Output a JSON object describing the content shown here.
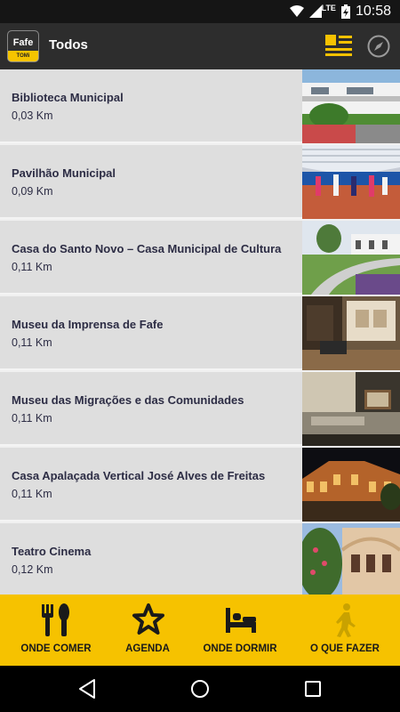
{
  "status": {
    "time": "10:58",
    "network": "LTE"
  },
  "app": {
    "logo_title": "Fafe",
    "logo_tag": "TOMi",
    "title": "Todos"
  },
  "icons": {
    "view_toggle": "list-view-icon",
    "compass": "compass-icon"
  },
  "colors": {
    "accent": "#f6c200",
    "appbar": "#2d2d2d",
    "row_bg": "#dedede",
    "text": "#2c2c44"
  },
  "places": [
    {
      "name": "Biblioteca Municipal",
      "distance": "0,03 Km",
      "image": "library-building-photo"
    },
    {
      "name": "Pavilhão Municipal",
      "distance": "0,09 Km",
      "image": "sports-hall-photo"
    },
    {
      "name": "Casa do Santo Novo – Casa Municipal de Cultura",
      "distance": "0,11 Km",
      "image": "garden-building-photo"
    },
    {
      "name": "Museu da Imprensa de Fafe",
      "distance": "0,11 Km",
      "image": "museum-interior-photo"
    },
    {
      "name": "Museu das Migrações e das Comunidades",
      "distance": "0,11 Km",
      "image": "exhibition-photo"
    },
    {
      "name": "Casa Apalaçada Vertical José Alves de Freitas",
      "distance": "0,11 Km",
      "image": "night-palace-photo"
    },
    {
      "name": "Teatro Cinema",
      "distance": "0,12 Km",
      "image": "theatre-facade-photo"
    }
  ],
  "tabs": [
    {
      "label": "ONDE COMER",
      "icon": "fork-knife-icon"
    },
    {
      "label": "AGENDA",
      "icon": "star-icon"
    },
    {
      "label": "ONDE DORMIR",
      "icon": "bed-icon"
    },
    {
      "label": "O QUE FAZER",
      "icon": "walking-person-icon"
    }
  ]
}
